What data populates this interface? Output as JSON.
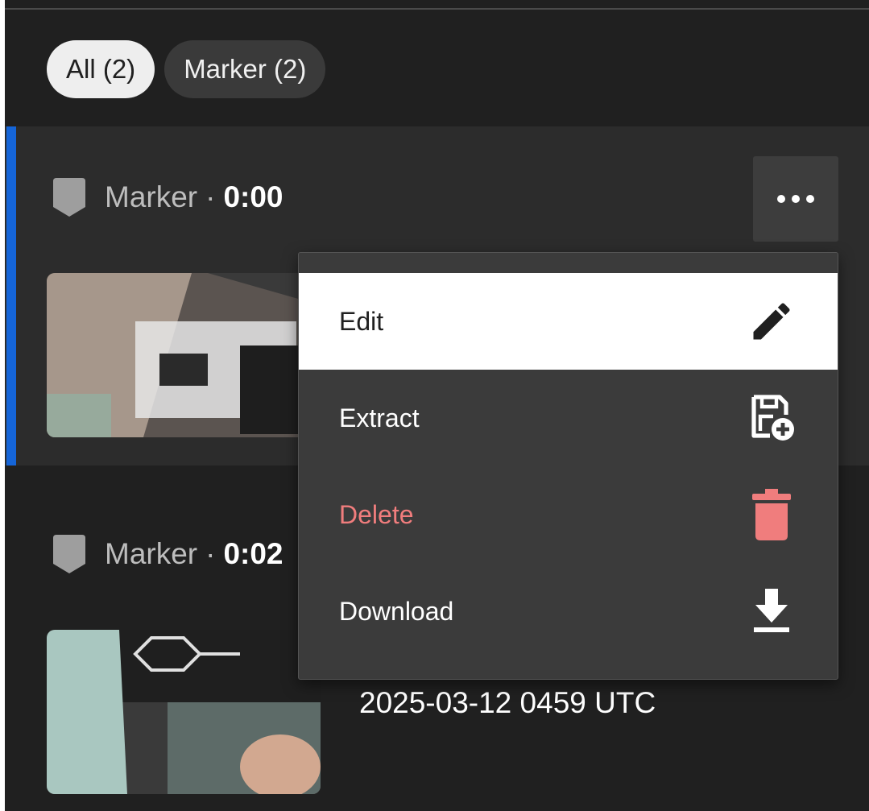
{
  "filters": {
    "all_label": "All (2)",
    "marker_label": "Marker (2)"
  },
  "markers": [
    {
      "type_label": "Marker",
      "separator": "·",
      "time": "0:00"
    },
    {
      "type_label": "Marker",
      "separator": "·",
      "time": "0:02",
      "date": "2025-03-12 0459 UTC"
    }
  ],
  "context_menu": {
    "items": [
      {
        "label": "Edit",
        "icon": "pencil-icon"
      },
      {
        "label": "Extract",
        "icon": "extract-icon"
      },
      {
        "label": "Delete",
        "icon": "trash-icon"
      },
      {
        "label": "Download",
        "icon": "download-icon"
      }
    ]
  },
  "colors": {
    "accent": "#1565d8",
    "danger": "#f07d7d",
    "background": "#202020",
    "selected_card": "#2c2c2c"
  }
}
